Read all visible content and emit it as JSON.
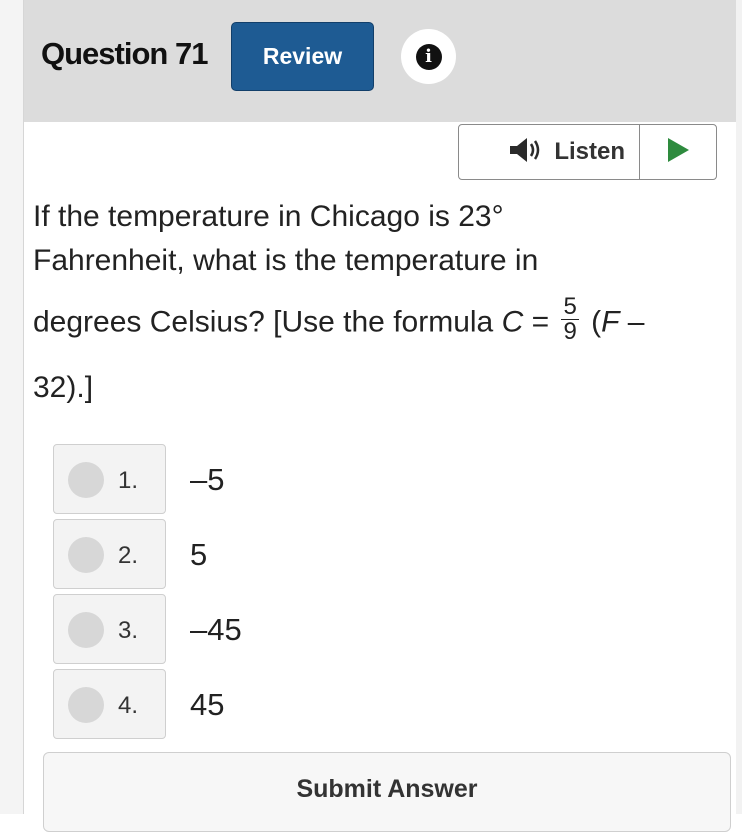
{
  "header": {
    "title": "Question 71",
    "review_label": "Review",
    "info_glyph": "i"
  },
  "listen": {
    "label": "Listen",
    "speaker_icon": "speaker-icon",
    "play_icon": "play-icon",
    "play_color": "#2e8b3e"
  },
  "question": {
    "line1": "If the temperature in Chicago is 23°",
    "line2": "Fahrenheit, what is the temperature in",
    "line3_text": "degrees Celsius? [Use the formula ",
    "formula_var": "C",
    "formula_eq": " = ",
    "fraction_numerator": "5",
    "fraction_denominator": "9",
    "formula_open": " (",
    "formula_f": "F",
    "formula_minus": " –",
    "line4": "32).]"
  },
  "choices": [
    {
      "number": "1.",
      "text": "–5"
    },
    {
      "number": "2.",
      "text": "5"
    },
    {
      "number": "3.",
      "text": "–45"
    },
    {
      "number": "4.",
      "text": "45"
    }
  ],
  "submit_label": "Submit Answer",
  "colors": {
    "header_bg": "#dcdcdc",
    "review_bg": "#1e5b93",
    "play": "#2e8b3e"
  }
}
